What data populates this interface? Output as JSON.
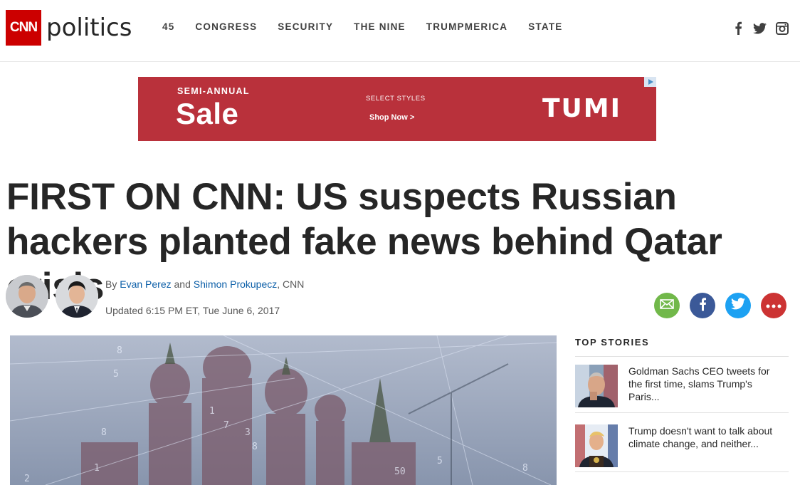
{
  "header": {
    "logo_text": "CNN",
    "section": "politics",
    "nav": [
      "45",
      "CONGRESS",
      "SECURITY",
      "THE NINE",
      "TRUMPMERICA",
      "STATE"
    ],
    "social_icons": [
      "facebook-icon",
      "twitter-icon",
      "instagram-icon"
    ]
  },
  "ad": {
    "small": "SEMI-ANNUAL",
    "big": "Sale",
    "select": "SELECT STYLES",
    "shop": "Shop Now >",
    "brand": "TUMI",
    "bg": "#b9313b"
  },
  "article": {
    "headline": "FIRST ON CNN: US suspects Russian hackers planted fake news behind Qatar crisis",
    "by": "By",
    "author1": "Evan Perez",
    "and": "and",
    "author2": "Shimon Prokupecz",
    "outlet": ", CNN",
    "updated": "Updated 6:15 PM ET, Tue June 6, 2017"
  },
  "share": [
    "email-icon",
    "facebook-icon",
    "twitter-icon",
    "more-icon"
  ],
  "top_stories": {
    "title": "TOP STORIES",
    "items": [
      {
        "text": "Goldman Sachs CEO tweets for the first time, slams Trump's Paris..."
      },
      {
        "text": "Trump doesn't want to talk about climate change, and neither..."
      }
    ]
  },
  "colors": {
    "cnn_red": "#cc0000",
    "link_blue": "#0c5fa8"
  }
}
